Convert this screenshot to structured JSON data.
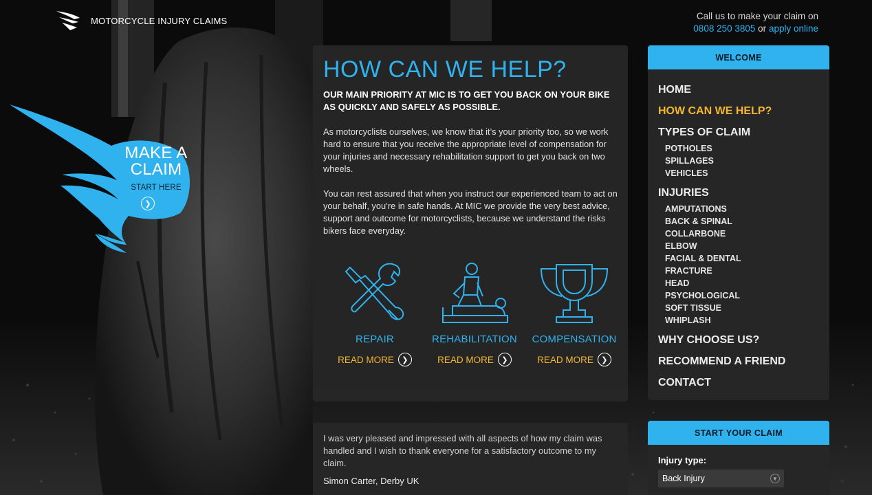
{
  "header": {
    "logo_text": "MOTORCYCLE INJURY CLAIMS",
    "call_text": "Call us to make your claim on",
    "phone": "0808 250 3805",
    "or_text": "or",
    "apply_link": "apply online"
  },
  "claim_wing": {
    "title": "MAKE A CLAIM",
    "subtitle": "START HERE"
  },
  "main": {
    "title": "HOW CAN WE HELP?",
    "lead": "OUR MAIN PRIORITY AT MIC IS TO GET YOU BACK ON YOUR BIKE AS QUICKLY AND SAFELY AS POSSIBLE.",
    "para1": "As motorcyclists ourselves, we know that it’s your priority too, so we work hard to ensure that you receive the appropriate level of compensation for your injuries and necessary rehabilitation support to get you back on two wheels.",
    "para2": "You can rest assured that when you instruct our experienced team to act on your behalf, you’re in safe hands. At MIC we provide the very best advice, support and outcome for motorcyclists, because we understand the risks bikers face everyday.",
    "services": [
      {
        "label": "REPAIR",
        "more": "READ MORE",
        "icon": "tools-icon"
      },
      {
        "label": "REHABILITATION",
        "more": "READ MORE",
        "icon": "physio-icon"
      },
      {
        "label": "COMPENSATION",
        "more": "READ MORE",
        "icon": "trophy-icon"
      }
    ]
  },
  "testimonial": {
    "quote": "I was very pleased and impressed with all aspects of how my claim was handled and I wish to thank everyone for a satisfactory outcome to my claim.",
    "author": "Simon Carter, Derby UK"
  },
  "nav": {
    "heading": "WELCOME",
    "home": "HOME",
    "help": "HOW CAN WE HELP?",
    "types": "TYPES OF CLAIM",
    "types_sub": [
      "POTHOLES",
      "SPILLAGES",
      "VEHICLES"
    ],
    "injuries": "INJURIES",
    "injuries_sub": [
      "AMPUTATIONS",
      "BACK & SPINAL",
      "COLLARBONE",
      "ELBOW",
      "FACIAL & DENTAL",
      "FRACTURE",
      "HEAD",
      "PSYCHOLOGICAL",
      "SOFT TISSUE",
      "WHIPLASH"
    ],
    "why": "WHY CHOOSE US?",
    "recommend": "RECOMMEND A FRIEND",
    "contact": "CONTACT"
  },
  "start_claim": {
    "heading": "START YOUR CLAIM",
    "injury_label": "Injury type:",
    "injury_value": "Back Injury"
  },
  "colors": {
    "accent": "#2fb2ee",
    "highlight": "#f5b731",
    "panel": "#262626",
    "background": "#0c0c0c"
  }
}
